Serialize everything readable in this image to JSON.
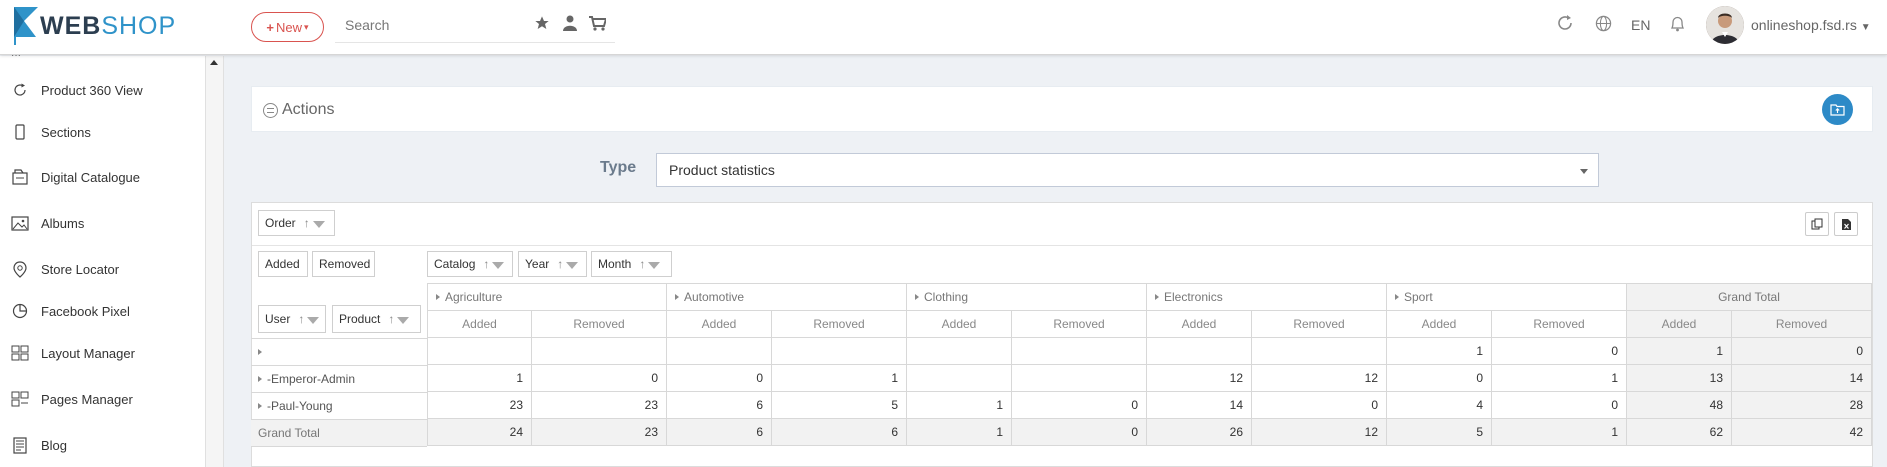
{
  "header": {
    "logo_a": "WEB",
    "logo_b": "SHOP",
    "new_label": "New",
    "search_placeholder": "Search",
    "lang": "EN",
    "user": "onlineshop.fsd.rs"
  },
  "sidebar": {
    "items": [
      {
        "label": "Product 360 View",
        "icon": "refresh-icon"
      },
      {
        "label": "Sections",
        "icon": "mobile-icon"
      },
      {
        "label": "Digital Catalogue",
        "icon": "catalogue-icon"
      },
      {
        "label": "Albums",
        "icon": "image-icon"
      },
      {
        "label": "Store Locator",
        "icon": "store-icon"
      },
      {
        "label": "Facebook Pixel",
        "icon": "pie-chart-icon"
      },
      {
        "label": "Layout Manager",
        "icon": "layout-icon"
      },
      {
        "label": "Pages Manager",
        "icon": "pages-icon"
      },
      {
        "label": "Blog",
        "icon": "blog-icon"
      }
    ]
  },
  "actions": {
    "title": "Actions"
  },
  "type": {
    "label": "Type",
    "value": "Product statistics"
  },
  "pivot": {
    "filter_fields": [
      "Order"
    ],
    "data_fields": [
      "Added",
      "Removed"
    ],
    "column_fields": [
      "Catalog",
      "Year",
      "Month"
    ],
    "row_fields": [
      "User",
      "Product"
    ],
    "categories": [
      "Agriculture",
      "Automotive",
      "Clothing",
      "Electronics",
      "Sport"
    ],
    "grand_total": "Grand Total",
    "measures": [
      "Added",
      "Removed"
    ],
    "rows": [
      {
        "label": "",
        "values": [
          "",
          "",
          "",
          "",
          "",
          "",
          "",
          "",
          "1",
          "0",
          "1",
          "0"
        ]
      },
      {
        "label": "-Emperor-Admin",
        "values": [
          "1",
          "0",
          "0",
          "1",
          "",
          "",
          "12",
          "12",
          "0",
          "1",
          "13",
          "14"
        ]
      },
      {
        "label": "-Paul-Young",
        "values": [
          "23",
          "23",
          "6",
          "5",
          "1",
          "0",
          "14",
          "0",
          "4",
          "0",
          "48",
          "28"
        ]
      },
      {
        "label": "Grand Total",
        "values": [
          "24",
          "23",
          "6",
          "6",
          "1",
          "0",
          "26",
          "12",
          "5",
          "1",
          "62",
          "42"
        ]
      }
    ]
  }
}
